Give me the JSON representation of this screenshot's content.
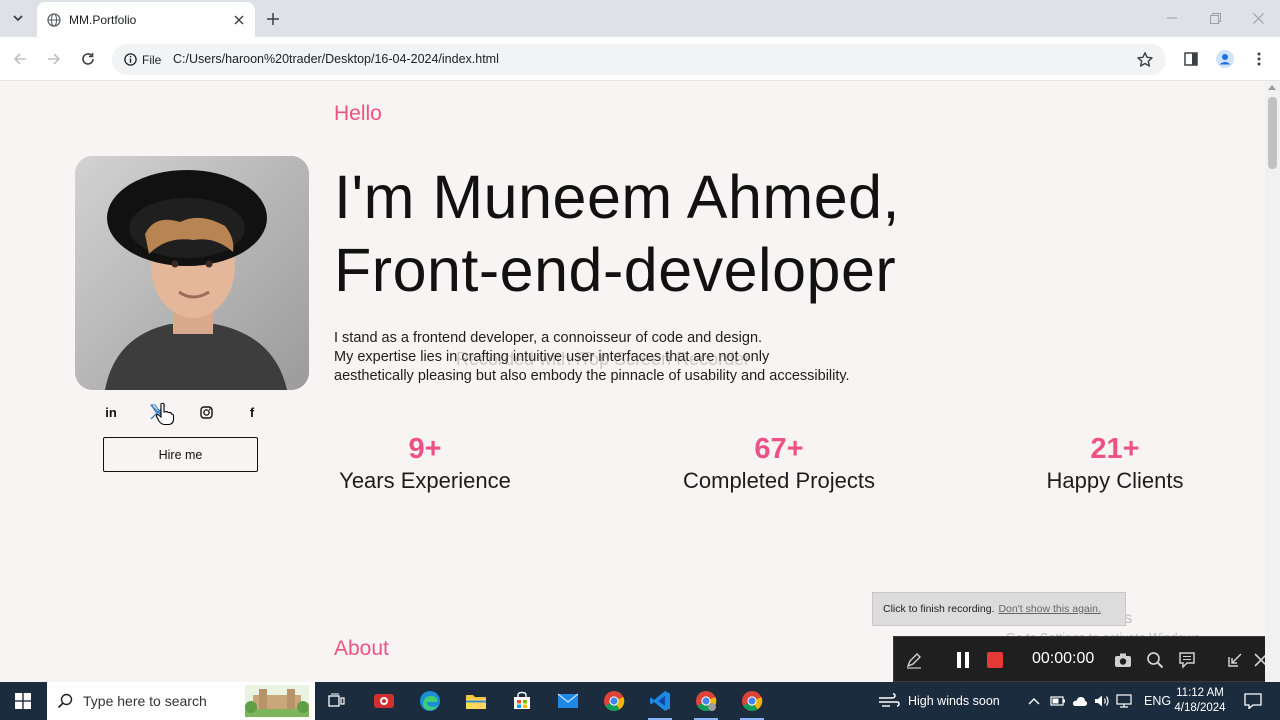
{
  "browser": {
    "tab_title": "MM.Portfolio",
    "site_chip_label": "File",
    "url": "C:/Users/haroon%20trader/Desktop/16-04-2024/index.html"
  },
  "page": {
    "greeting": "Hello",
    "headline_line1": "I'm Muneem Ahmed,",
    "headline_line2": "Front-end-developer",
    "intro_lines": [
      "I stand as a frontend developer, a connoisseur of code and design.",
      "My expertise lies in crafting intuitive user interfaces that are not only",
      "aesthetically pleasing but also embody the pinnacle of usability and accessibility."
    ],
    "watermark": "Recorded with iTop Screen Recorder",
    "socials": [
      {
        "icon": "linkedin-icon",
        "glyph": "in"
      },
      {
        "icon": "x-twitter-icon",
        "glyph": "X"
      },
      {
        "icon": "instagram-icon",
        "glyph": ""
      },
      {
        "icon": "facebook-icon",
        "glyph": "f"
      }
    ],
    "hire_label": "Hire me",
    "stats": [
      {
        "value": "9+",
        "label": "Years Experience"
      },
      {
        "value": "67+",
        "label": "Completed Projects"
      },
      {
        "value": "21+",
        "label": "Happy Clients"
      }
    ],
    "about_heading": "About",
    "accent_color": "#ec5286"
  },
  "overlays": {
    "recording_tip": "Click to finish recording.",
    "recording_tip_link": "Don't show this again.",
    "recording_time": "00:00:00",
    "activate_title": "Activate Windows",
    "activate_sub": "Go to Settings to activate Windows."
  },
  "taskbar": {
    "search_placeholder": "Type here to search",
    "weather": "High winds soon",
    "language": "ENG",
    "time": "11:12 AM",
    "date": "4/18/2024"
  }
}
